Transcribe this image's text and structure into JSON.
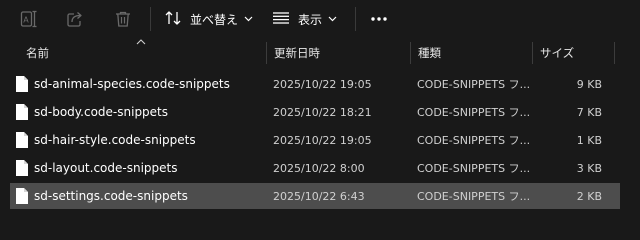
{
  "toolbar": {
    "sort_label": "並べ替え",
    "view_label": "表示",
    "icons": {
      "rename": "rename-icon",
      "share": "share-icon",
      "delete": "trash-icon",
      "sort": "sort-arrows-icon",
      "view": "lines-icon",
      "more": "more-dots-icon"
    }
  },
  "columns": {
    "name": "名前",
    "date": "更新日時",
    "type": "種類",
    "size": "サイズ"
  },
  "files": [
    {
      "name": "sd-animal-species.code-snippets",
      "date": "2025/10/22 19:05",
      "type": "CODE-SNIPPETS フ...",
      "size": "9 KB",
      "selected": false
    },
    {
      "name": "sd-body.code-snippets",
      "date": "2025/10/22 18:21",
      "type": "CODE-SNIPPETS フ...",
      "size": "7 KB",
      "selected": false
    },
    {
      "name": "sd-hair-style.code-snippets",
      "date": "2025/10/22 19:05",
      "type": "CODE-SNIPPETS フ...",
      "size": "1 KB",
      "selected": false
    },
    {
      "name": "sd-layout.code-snippets",
      "date": "2025/10/22 8:00",
      "type": "CODE-SNIPPETS フ...",
      "size": "3 KB",
      "selected": false
    },
    {
      "name": "sd-settings.code-snippets",
      "date": "2025/10/22 6:43",
      "type": "CODE-SNIPPETS フ...",
      "size": "2 KB",
      "selected": true
    }
  ],
  "colors": {
    "background": "#191919",
    "selected_row": "#4d4d4d",
    "disabled_icon": "#6a6a6a"
  }
}
